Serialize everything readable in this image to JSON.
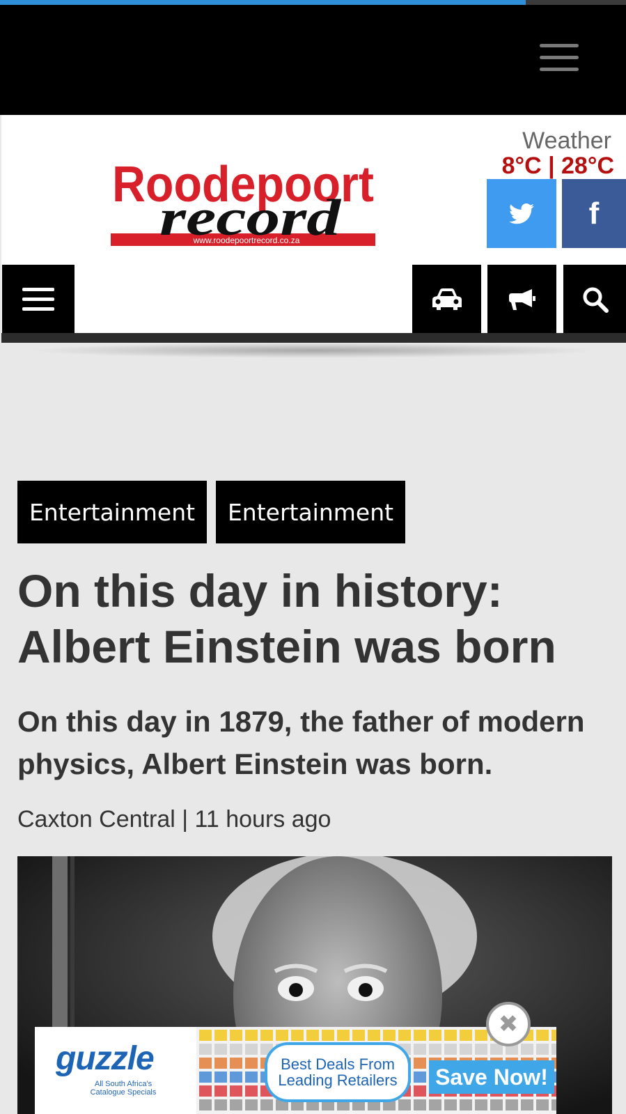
{
  "page_progress": {
    "fraction": 0.84,
    "color": "#2f8fd8"
  },
  "header": {
    "logo_text_top": "Roodepoort",
    "logo_text_bottom": "record",
    "logo_url": "www.roodepoortrecord.co.za"
  },
  "weather": {
    "label": "Weather",
    "temps": "8°C | 28°C"
  },
  "social": {
    "twitter_icon": "twitter-icon",
    "facebook_glyph": "f"
  },
  "nav": {
    "icons": [
      "menu-icon",
      "car-icon",
      "megaphone-icon",
      "search-icon"
    ]
  },
  "article": {
    "tags": [
      "Entertainment",
      "Entertainment"
    ],
    "title": "On this day in history: Albert Einstein was born",
    "lead": "On this day in 1879, the father of modern physics, Albert Einstein was born.",
    "byline": "Caxton Central | 11 hours ago"
  },
  "ad": {
    "brand": "guzzle",
    "tagline": "All South Africa's Catalogue Specials",
    "bubble_line1": "Best Deals From",
    "bubble_line2": "Leading Retailers",
    "cta": "Save Now!",
    "close_glyph": "✖"
  },
  "colors": {
    "brand_red": "#d8202a",
    "weather_red": "#b50f0f",
    "twitter": "#3f9bf0",
    "facebook": "#3a5a98",
    "ad_blue": "#3fa6e8"
  }
}
